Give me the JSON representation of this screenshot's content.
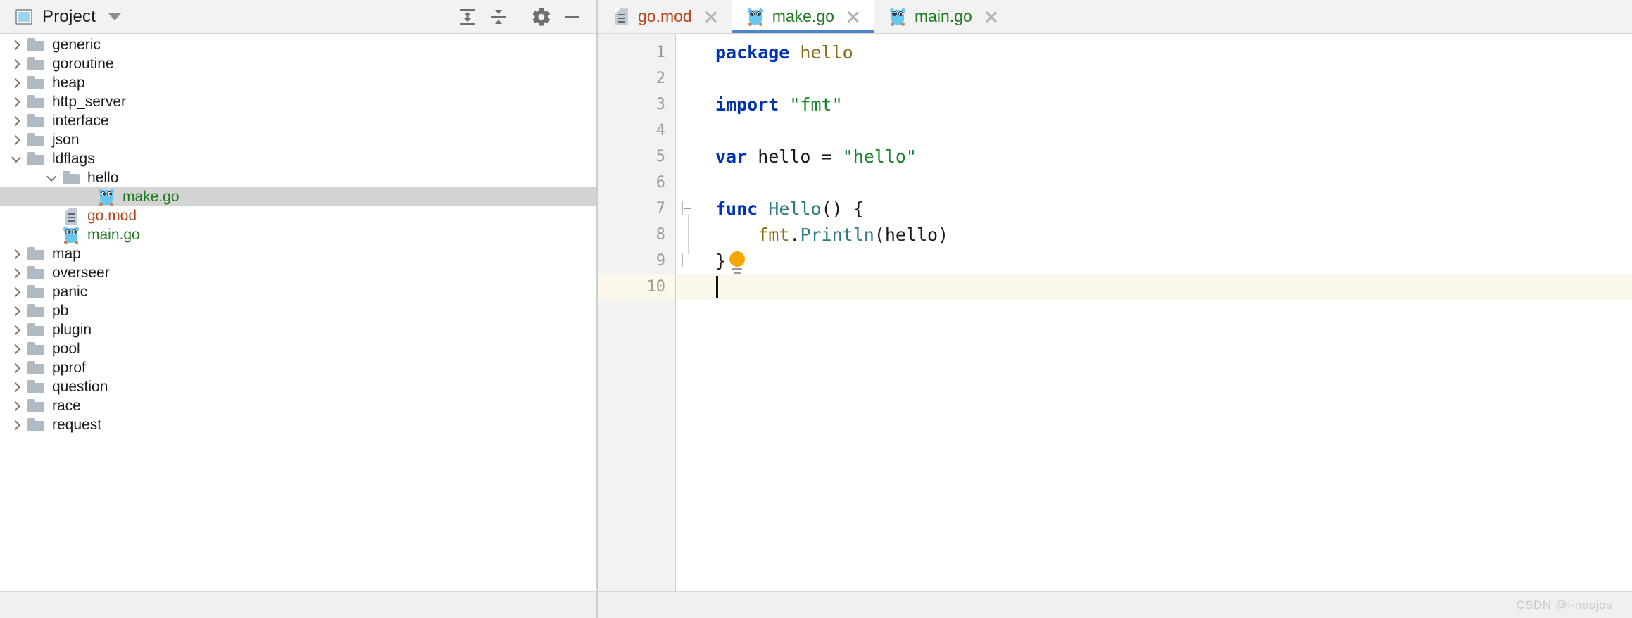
{
  "window": {
    "watermark": "CSDN @i-neojos"
  },
  "project_panel": {
    "icon": "project-square-icon",
    "title": "Project",
    "dropdown_icon": "chevron-down-icon",
    "toolbar": [
      {
        "name": "expand-all-button",
        "icon": "expand-all-icon",
        "label": "Expand All"
      },
      {
        "name": "collapse-all-button",
        "icon": "collapse-all-icon",
        "label": "Collapse All"
      },
      {
        "name": "settings-button",
        "icon": "gear-icon",
        "label": "Settings"
      },
      {
        "name": "hide-button",
        "icon": "minus-icon",
        "label": "Hide"
      }
    ],
    "tree": [
      {
        "label": "generic",
        "type": "folder",
        "depth": 1,
        "state": "collapsed",
        "selected": false
      },
      {
        "label": "goroutine",
        "type": "folder",
        "depth": 1,
        "state": "collapsed",
        "selected": false
      },
      {
        "label": "heap",
        "type": "folder",
        "depth": 1,
        "state": "collapsed",
        "selected": false
      },
      {
        "label": "http_server",
        "type": "folder",
        "depth": 1,
        "state": "collapsed",
        "selected": false
      },
      {
        "label": "interface",
        "type": "folder",
        "depth": 1,
        "state": "collapsed",
        "selected": false
      },
      {
        "label": "json",
        "type": "folder",
        "depth": 1,
        "state": "collapsed",
        "selected": false
      },
      {
        "label": "ldflags",
        "type": "folder",
        "depth": 1,
        "state": "expanded",
        "selected": false
      },
      {
        "label": "hello",
        "type": "folder",
        "depth": 2,
        "state": "expanded",
        "selected": false
      },
      {
        "label": "make.go",
        "type": "go",
        "depth": 3,
        "state": "leaf",
        "selected": true
      },
      {
        "label": "go.mod",
        "type": "mod",
        "depth": 2,
        "state": "leaf",
        "selected": false
      },
      {
        "label": "main.go",
        "type": "go",
        "depth": 2,
        "state": "leaf",
        "selected": false
      },
      {
        "label": "map",
        "type": "folder",
        "depth": 1,
        "state": "collapsed",
        "selected": false
      },
      {
        "label": "overseer",
        "type": "folder",
        "depth": 1,
        "state": "collapsed",
        "selected": false
      },
      {
        "label": "panic",
        "type": "folder",
        "depth": 1,
        "state": "collapsed",
        "selected": false
      },
      {
        "label": "pb",
        "type": "folder",
        "depth": 1,
        "state": "collapsed",
        "selected": false
      },
      {
        "label": "plugin",
        "type": "folder",
        "depth": 1,
        "state": "collapsed",
        "selected": false
      },
      {
        "label": "pool",
        "type": "folder",
        "depth": 1,
        "state": "collapsed",
        "selected": false
      },
      {
        "label": "pprof",
        "type": "folder",
        "depth": 1,
        "state": "collapsed",
        "selected": false
      },
      {
        "label": "question",
        "type": "folder",
        "depth": 1,
        "state": "collapsed",
        "selected": false
      },
      {
        "label": "race",
        "type": "folder",
        "depth": 1,
        "state": "collapsed",
        "selected": false
      },
      {
        "label": "request",
        "type": "folder",
        "depth": 1,
        "state": "collapsed",
        "selected": false
      }
    ]
  },
  "editor": {
    "tabs": [
      {
        "label": "go.mod",
        "icon": "file-icon",
        "active": false,
        "kind": "mod"
      },
      {
        "label": "make.go",
        "icon": "gopher-icon",
        "active": true,
        "kind": "go"
      },
      {
        "label": "main.go",
        "icon": "gopher-icon",
        "active": false,
        "kind": "go"
      }
    ],
    "close_icon": "close-icon",
    "line_numbers": [
      "1",
      "2",
      "3",
      "4",
      "5",
      "6",
      "7",
      "8",
      "9",
      "10"
    ],
    "current_line": 10,
    "lines": [
      {
        "n": 1,
        "tokens": [
          {
            "t": "package",
            "c": "kw"
          },
          {
            "t": " ",
            "c": "plain"
          },
          {
            "t": "hello",
            "c": "pkg"
          }
        ]
      },
      {
        "n": 2,
        "tokens": []
      },
      {
        "n": 3,
        "tokens": [
          {
            "t": "import",
            "c": "kw"
          },
          {
            "t": " ",
            "c": "plain"
          },
          {
            "t": "\"fmt\"",
            "c": "str"
          }
        ]
      },
      {
        "n": 4,
        "tokens": []
      },
      {
        "n": 5,
        "tokens": [
          {
            "t": "var",
            "c": "kw"
          },
          {
            "t": " hello = ",
            "c": "plain"
          },
          {
            "t": "\"hello\"",
            "c": "str"
          }
        ]
      },
      {
        "n": 6,
        "tokens": []
      },
      {
        "n": 7,
        "tokens": [
          {
            "t": "func",
            "c": "kw"
          },
          {
            "t": " ",
            "c": "plain"
          },
          {
            "t": "Hello",
            "c": "fn"
          },
          {
            "t": "() {",
            "c": "plain"
          }
        ]
      },
      {
        "n": 8,
        "tokens": [
          {
            "t": "    ",
            "c": "plain"
          },
          {
            "t": "fmt",
            "c": "pkg"
          },
          {
            "t": ".",
            "c": "plain"
          },
          {
            "t": "Println",
            "c": "fn"
          },
          {
            "t": "(hello)",
            "c": "plain"
          }
        ]
      },
      {
        "n": 9,
        "tokens": [
          {
            "t": "}",
            "c": "plain"
          }
        ]
      },
      {
        "n": 10,
        "tokens": []
      }
    ],
    "fold_markers": [
      {
        "line": 7,
        "kind": "open",
        "name": "fold-region-start"
      },
      {
        "line": 9,
        "kind": "close",
        "name": "fold-region-end"
      }
    ],
    "intention_bulb": {
      "line": 9,
      "icon": "lightbulb-icon",
      "color": "#f5a700"
    }
  },
  "colors": {
    "accent": "#4a86c8",
    "go_green": "#1f7a1f",
    "mod_orange": "#b5451b",
    "keyword_blue": "#0033b3",
    "string_green": "#17842a",
    "function_teal": "#2d7a85",
    "package_gold": "#8a6d1b",
    "selection_gray": "#d4d4d4",
    "current_line": "#fbf8e9"
  }
}
